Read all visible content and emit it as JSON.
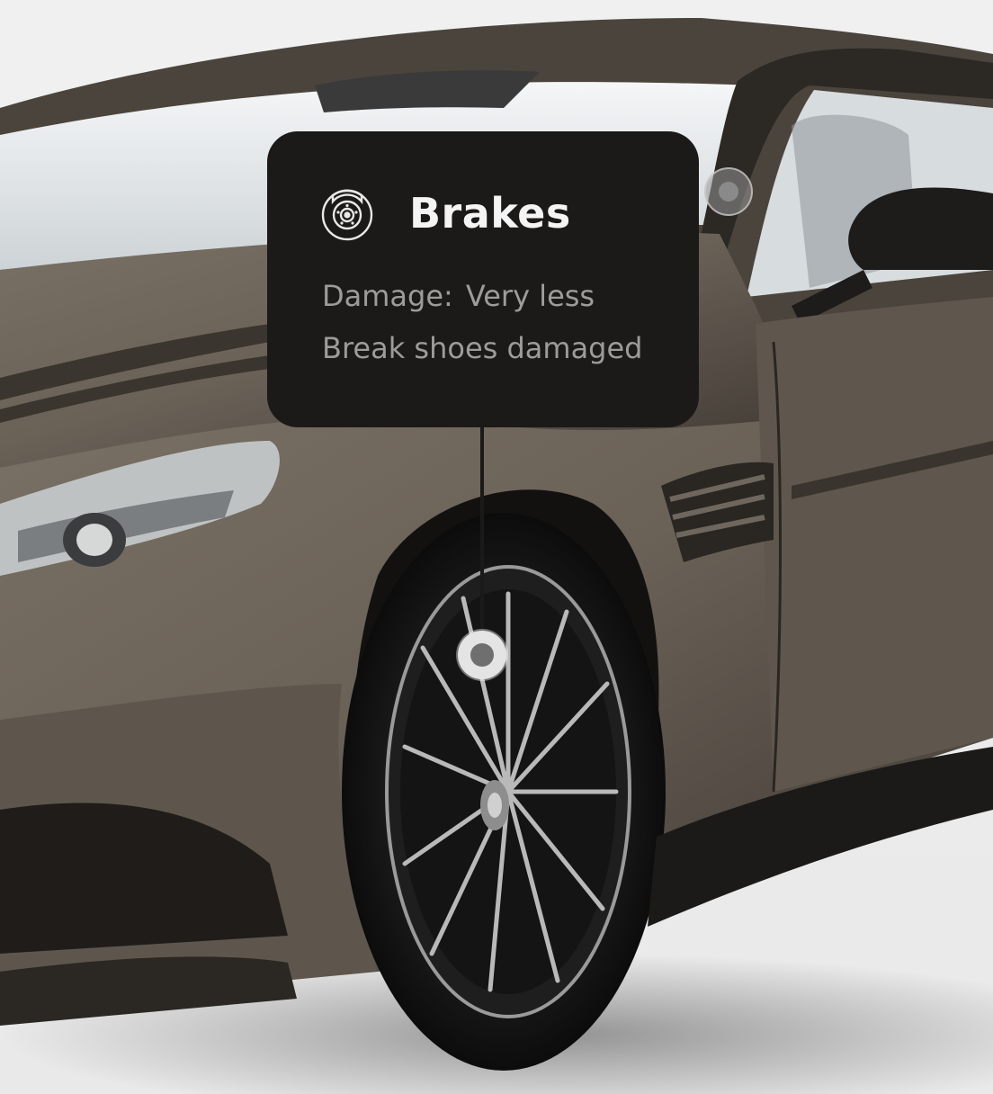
{
  "tooltip": {
    "title": "Brakes",
    "icon": "brake-disc-icon",
    "damage_label": "Damage:",
    "damage_value": "Very less",
    "description": "Break shoes damaged"
  },
  "hotspots": [
    {
      "name": "window-hotspot",
      "state": "inactive"
    },
    {
      "name": "brakes-hotspot",
      "state": "active"
    }
  ],
  "colors": {
    "tooltip_bg": "#1b1a19",
    "title_text": "#f4f4f4",
    "body_text": "#9c9c9c",
    "car_paint": "#6b6257",
    "background": "#ececec"
  }
}
